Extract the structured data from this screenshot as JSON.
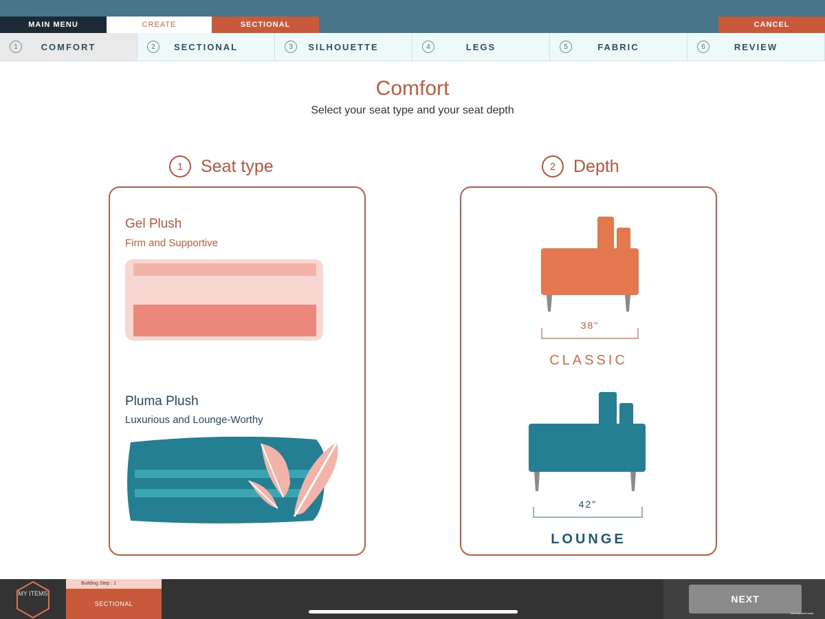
{
  "topbar": {
    "main_menu": "MAIN MENU",
    "create": "CREATE",
    "sectional": "SECTIONAL",
    "cancel": "CANCEL"
  },
  "steps": [
    {
      "num": "1",
      "label": "COMFORT"
    },
    {
      "num": "2",
      "label": "SECTIONAL"
    },
    {
      "num": "3",
      "label": "SILHOUETTE"
    },
    {
      "num": "4",
      "label": "LEGS"
    },
    {
      "num": "5",
      "label": "FABRIC"
    },
    {
      "num": "6",
      "label": "REVIEW"
    }
  ],
  "page": {
    "title": "Comfort",
    "subtitle": "Select your seat type and your seat depth"
  },
  "seat_type": {
    "num": "1",
    "heading": "Seat type",
    "options": [
      {
        "title": "Gel Plush",
        "subtitle": "Firm and Supportive"
      },
      {
        "title": "Pluma Plush",
        "subtitle": "Luxurious and Lounge-Worthy"
      }
    ]
  },
  "depth": {
    "num": "2",
    "heading": "Depth",
    "options": [
      {
        "dimension": "38\"",
        "label": "CLASSIC"
      },
      {
        "dimension": "42\"",
        "label": "LOUNGE"
      }
    ]
  },
  "bottombar": {
    "my_items": "MY ITEMS",
    "building_step": "Building Step : 1",
    "current": "SECTIONAL",
    "next": "NEXT",
    "dev_build": "Development build"
  },
  "colors": {
    "accent_rust": "#c25b3d",
    "header_teal": "#47758a",
    "gel_pink": "#ef8a7e",
    "pluma_teal": "#237f91",
    "classic_orange": "#e4774d"
  }
}
